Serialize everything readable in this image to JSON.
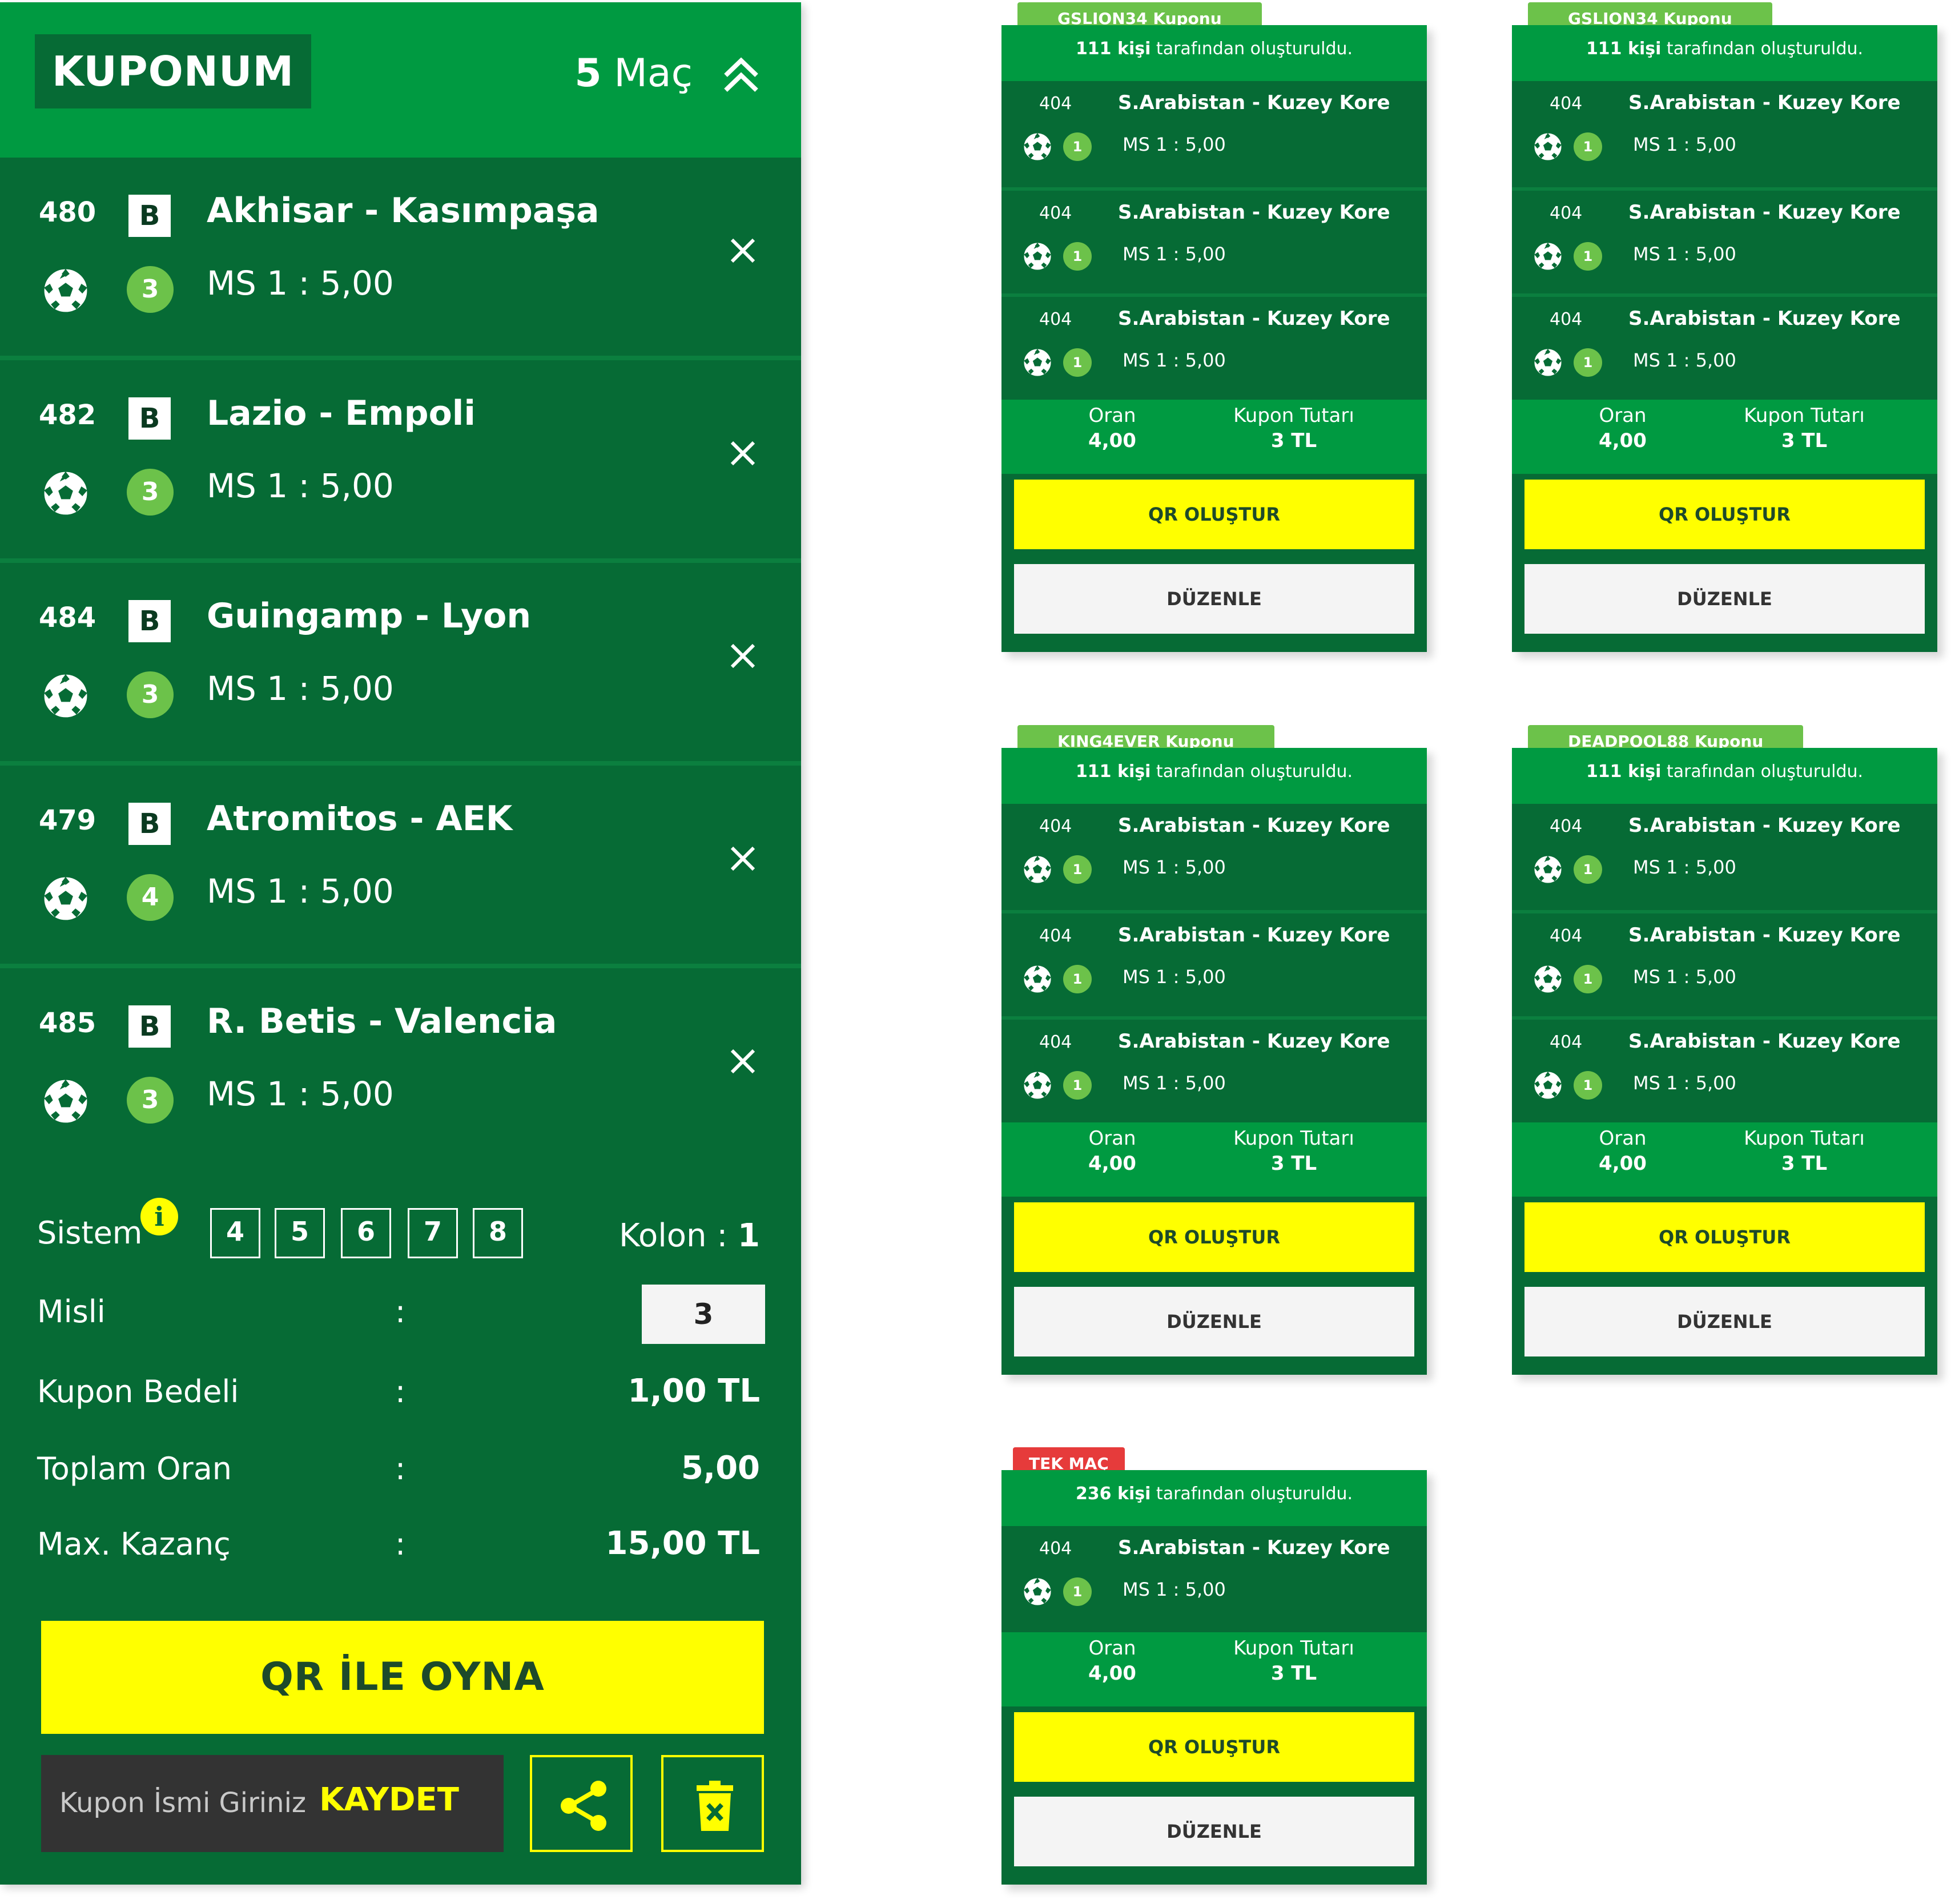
{
  "slip": {
    "title": "KUPONUM",
    "count_num": "5",
    "count_label": "Maç",
    "rows": [
      {
        "code": "480",
        "badge": "B",
        "match": "Akhisar - Kasımpaşa",
        "pick": "3",
        "odd": "MS 1 : 5,00"
      },
      {
        "code": "482",
        "badge": "B",
        "match": "Lazio - Empoli",
        "pick": "3",
        "odd": "MS 1 : 5,00"
      },
      {
        "code": "484",
        "badge": "B",
        "match": "Guingamp - Lyon",
        "pick": "3",
        "odd": "MS 1 : 5,00"
      },
      {
        "code": "479",
        "badge": "B",
        "match": "Atromitos - AEK",
        "pick": "4",
        "odd": "MS 1 : 5,00"
      },
      {
        "code": "485",
        "badge": "B",
        "match": "R. Betis - Valencia",
        "pick": "3",
        "odd": "MS 1 : 5,00"
      }
    ],
    "system_label": "Sistem",
    "info_glyph": "i",
    "system_options": [
      "4",
      "5",
      "6",
      "7",
      "8"
    ],
    "kolon_label": "Kolon :",
    "kolon_value": "1",
    "colon": ":",
    "misli_label": "Misli",
    "misli_value": "3",
    "bedel_label": "Kupon Bedeli",
    "bedel_value": "1,00 TL",
    "oran_label": "Toplam Oran",
    "oran_value": "5,00",
    "kazanc_label": "Max. Kazanç",
    "kazanc_value": "15,00 TL",
    "play_label": "QR İLE OYNA",
    "name_placeholder": "Kupon İsmi Giriniz",
    "save_label": "KAYDET",
    "share_icon": "share-icon",
    "delete_icon": "trash-icon"
  },
  "cards": [
    {
      "tag": "GSLION34 Kuponu",
      "tag_color": "#6cc24a",
      "by_count": "111 kişi",
      "by_text": " tarafından oluşturuldu.",
      "rows": [
        {
          "code": "404",
          "match": "S.Arabistan - Kuzey Kore",
          "pick": "1",
          "odd": "MS 1 : 5,00"
        },
        {
          "code": "404",
          "match": "S.Arabistan - Kuzey Kore",
          "pick": "1",
          "odd": "MS 1 : 5,00"
        },
        {
          "code": "404",
          "match": "S.Arabistan - Kuzey Kore",
          "pick": "1",
          "odd": "MS 1 : 5,00"
        }
      ],
      "oran_label": "Oran",
      "oran_value": "4,00",
      "tutar_label": "Kupon Tutarı",
      "tutar_value": "3 TL",
      "qr_label": "QR OLUŞTUR",
      "edit_label": "DÜZENLE"
    },
    {
      "tag": "GSLION34 Kuponu",
      "tag_color": "#6cc24a",
      "by_count": "111 kişi",
      "by_text": " tarafından oluşturuldu.",
      "rows": [
        {
          "code": "404",
          "match": "S.Arabistan - Kuzey Kore",
          "pick": "1",
          "odd": "MS 1 : 5,00"
        },
        {
          "code": "404",
          "match": "S.Arabistan - Kuzey Kore",
          "pick": "1",
          "odd": "MS 1 : 5,00"
        },
        {
          "code": "404",
          "match": "S.Arabistan - Kuzey Kore",
          "pick": "1",
          "odd": "MS 1 : 5,00"
        }
      ],
      "oran_label": "Oran",
      "oran_value": "4,00",
      "tutar_label": "Kupon Tutarı",
      "tutar_value": "3 TL",
      "qr_label": "QR OLUŞTUR",
      "edit_label": "DÜZENLE"
    },
    {
      "tag": "KING4EVER Kuponu",
      "tag_color": "#6cc24a",
      "by_count": "111 kişi",
      "by_text": " tarafından oluşturuldu.",
      "rows": [
        {
          "code": "404",
          "match": "S.Arabistan - Kuzey Kore",
          "pick": "1",
          "odd": "MS 1 : 5,00"
        },
        {
          "code": "404",
          "match": "S.Arabistan - Kuzey Kore",
          "pick": "1",
          "odd": "MS 1 : 5,00"
        },
        {
          "code": "404",
          "match": "S.Arabistan - Kuzey Kore",
          "pick": "1",
          "odd": "MS 1 : 5,00"
        }
      ],
      "oran_label": "Oran",
      "oran_value": "4,00",
      "tutar_label": "Kupon Tutarı",
      "tutar_value": "3 TL",
      "qr_label": "QR OLUŞTUR",
      "edit_label": "DÜZENLE"
    },
    {
      "tag": "DEADPOOL88 Kuponu",
      "tag_color": "#6cc24a",
      "by_count": "111 kişi",
      "by_text": " tarafından oluşturuldu.",
      "rows": [
        {
          "code": "404",
          "match": "S.Arabistan - Kuzey Kore",
          "pick": "1",
          "odd": "MS 1 : 5,00"
        },
        {
          "code": "404",
          "match": "S.Arabistan - Kuzey Kore",
          "pick": "1",
          "odd": "MS 1 : 5,00"
        },
        {
          "code": "404",
          "match": "S.Arabistan - Kuzey Kore",
          "pick": "1",
          "odd": "MS 1 : 5,00"
        }
      ],
      "oran_label": "Oran",
      "oran_value": "4,00",
      "tutar_label": "Kupon Tutarı",
      "tutar_value": "3 TL",
      "qr_label": "QR OLUŞTUR",
      "edit_label": "DÜZENLE"
    },
    {
      "tag": "TEK MAÇ",
      "tag_color": "#e63b3b",
      "by_count": "236 kişi",
      "by_text": " tarafından oluşturuldu.",
      "rows": [
        {
          "code": "404",
          "match": "S.Arabistan - Kuzey Kore",
          "pick": "1",
          "odd": "MS 1 : 5,00"
        }
      ],
      "oran_label": "Oran",
      "oran_value": "4,00",
      "tutar_label": "Kupon Tutarı",
      "tutar_value": "3 TL",
      "qr_label": "QR OLUŞTUR",
      "edit_label": "DÜZENLE"
    }
  ]
}
